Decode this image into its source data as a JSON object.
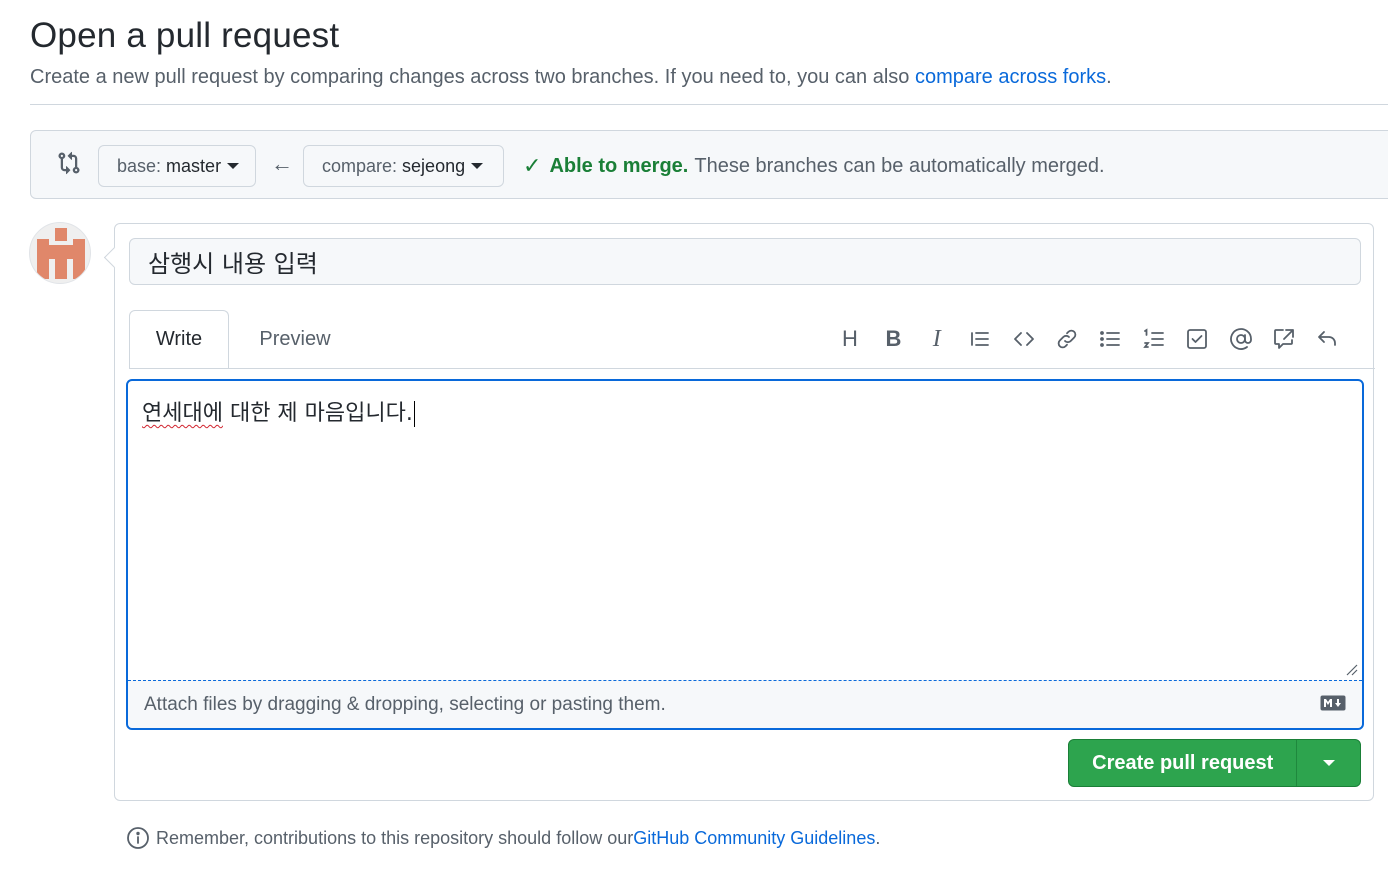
{
  "header": {
    "title": "Open a pull request",
    "subtitle_text": "Create a new pull request by comparing changes across two branches. If you need to, you can also ",
    "subtitle_link": "compare across forks",
    "subtitle_end": "."
  },
  "range": {
    "base_label": "base:",
    "base_value": "master",
    "compare_label": "compare:",
    "compare_value": "sejeong",
    "merge_ok": "Able to merge.",
    "merge_text": "These branches can be automatically merged."
  },
  "form": {
    "title_value": "삼행시 내용 입력",
    "tab_write": "Write",
    "tab_preview": "Preview",
    "toolbar": [
      "heading-icon",
      "bold-icon",
      "italic-icon",
      "quote-icon",
      "code-icon",
      "link-icon",
      "unordered-list-icon",
      "ordered-list-icon",
      "task-list-icon",
      "mention-icon",
      "reference-icon",
      "undo-icon"
    ],
    "body_word1": "연세대에",
    "body_rest": " 대한 제 마음입니다.",
    "attach_text": "Attach files by dragging & dropping, selecting or pasting them.",
    "create_label": "Create pull request"
  },
  "footer": {
    "text": "Remember, contributions to this repository should follow our ",
    "link": "GitHub Community Guidelines",
    "end": "."
  },
  "colors": {
    "accent": "#0969da",
    "success": "#1a7f37",
    "button_green": "#2da44e",
    "avatar": "#e0876a"
  }
}
